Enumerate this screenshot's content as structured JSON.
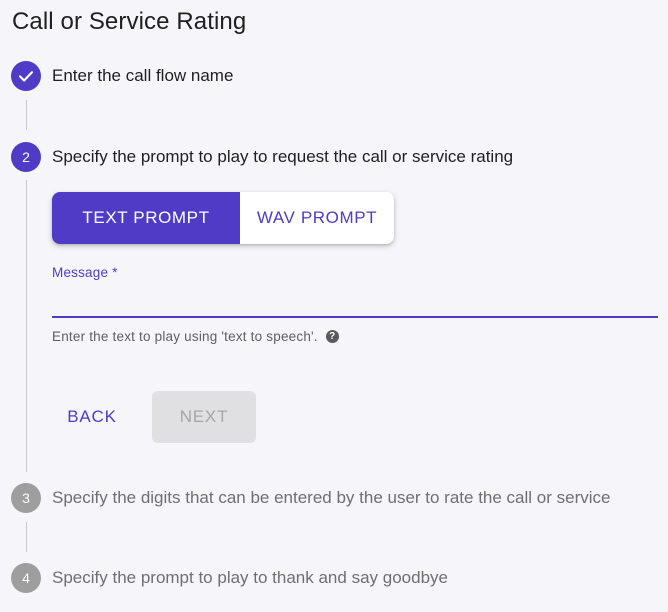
{
  "page": {
    "title": "Call or Service Rating"
  },
  "steps": [
    {
      "number": "1",
      "label": "Enter the call flow name",
      "state": "completed",
      "icon": "checkmark-icon"
    },
    {
      "number": "2",
      "label": "Specify the prompt to play to request the call or service rating",
      "state": "active"
    },
    {
      "number": "3",
      "label": "Specify the digits that can be entered by the user to rate the call or service",
      "state": "inactive"
    },
    {
      "number": "4",
      "label": "Specify the prompt to play to thank and say goodbye",
      "state": "inactive"
    }
  ],
  "prompt_toggle": {
    "options": [
      "TEXT PROMPT",
      "WAV PROMPT"
    ],
    "selected": "TEXT PROMPT"
  },
  "message_field": {
    "label": "Message *",
    "value": "",
    "helper_text": "Enter the text to play using 'text to speech'.",
    "help_icon": "question-mark-icon"
  },
  "actions": {
    "back_label": "BACK",
    "next_label": "NEXT",
    "next_disabled": true
  },
  "colors": {
    "accent": "#4f3bc6",
    "inactive_step": "#9e9e9e",
    "disabled_bg": "#e0e0e3",
    "background": "#f6f6fa"
  }
}
